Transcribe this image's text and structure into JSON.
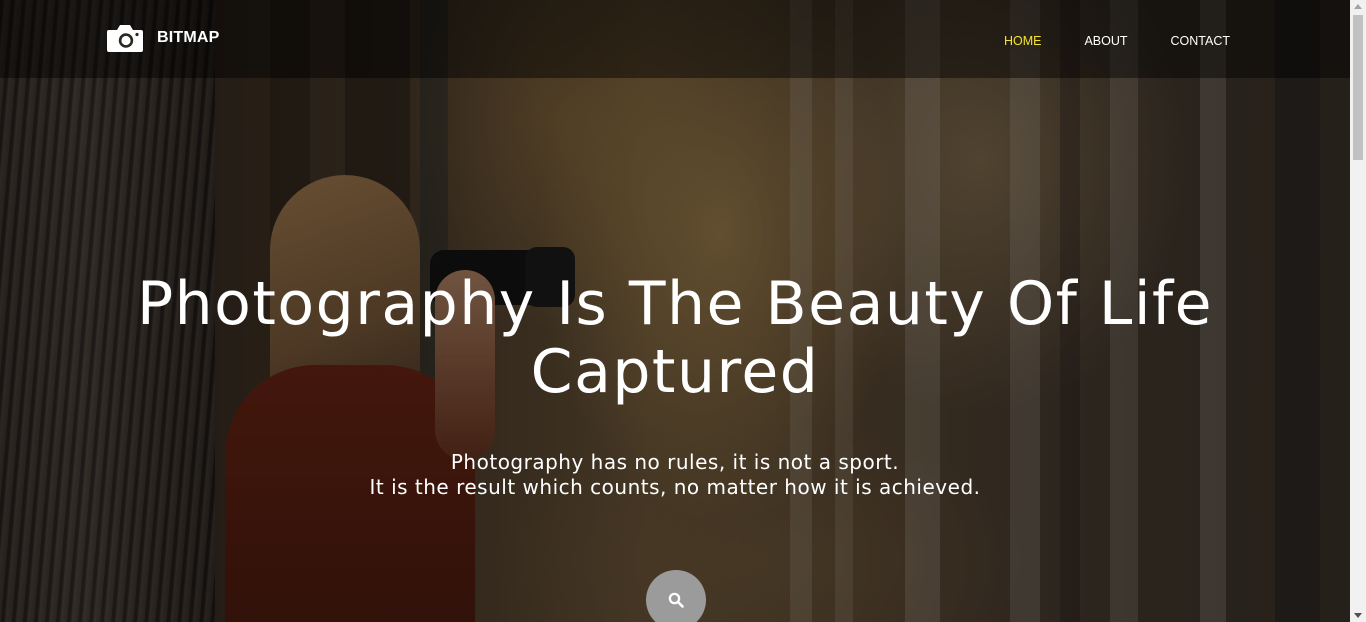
{
  "navbar": {
    "brand_name": "BITMAP",
    "brand_icon": "camera-icon",
    "items": [
      {
        "label": "HOME",
        "active": true
      },
      {
        "label": "ABOUT",
        "active": false
      },
      {
        "label": "CONTACT",
        "active": false
      }
    ]
  },
  "hero": {
    "title": "Photography Is The Beauty Of Life Captured",
    "subtitle_line1": "Photography has no rules, it is not a sport.",
    "subtitle_line2": "It is the result which counts, no matter how it is achieved.",
    "search_icon": "search-icon"
  },
  "colors": {
    "active_nav": "#f5e42b",
    "text": "#ffffff",
    "search_button": "#9b9b9b"
  }
}
